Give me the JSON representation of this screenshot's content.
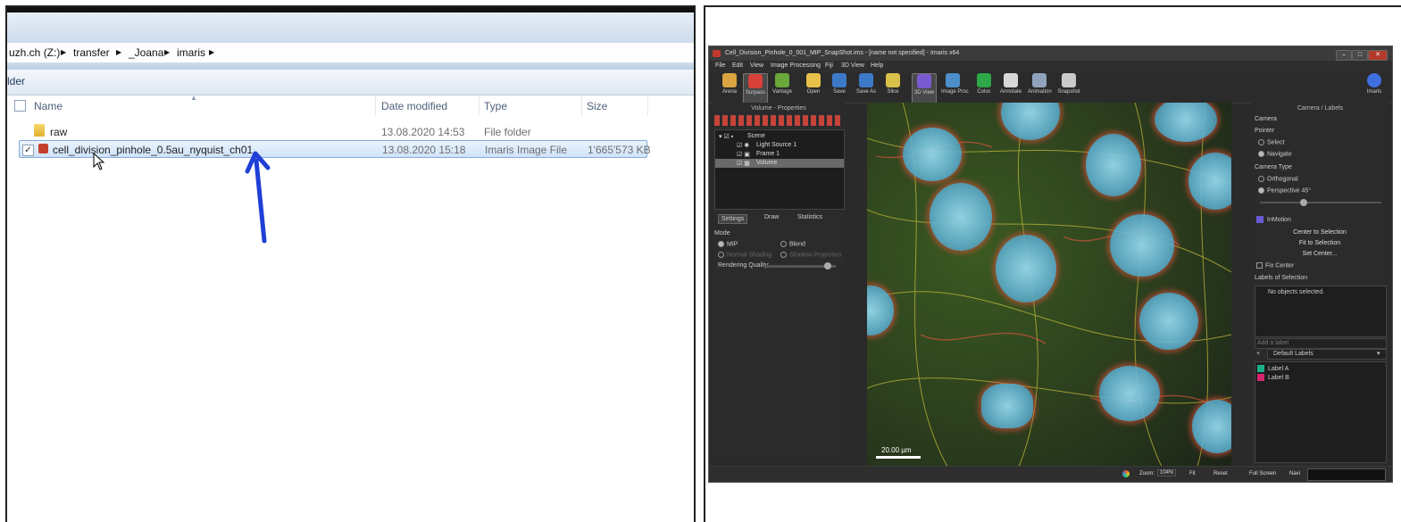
{
  "explorer": {
    "breadcrumb": [
      "uzh.ch (Z:)",
      "transfer",
      "_Joana",
      "imaris"
    ],
    "command_label": "lder",
    "columns": [
      "Name",
      "Date modified",
      "Type",
      "Size"
    ],
    "files": [
      {
        "name": "raw",
        "date": "13.08.2020 14:53",
        "type": "File folder",
        "size": "",
        "icon": "folder-icon",
        "checked": false
      },
      {
        "name": "cell_division_pinhole_0.5au_nyquist_ch01",
        "date": "13.08.2020 15:18",
        "type": "Imaris Image File",
        "size": "1'665'573 KB",
        "icon": "imaris-file-icon",
        "checked": true
      }
    ],
    "annotation": "arrow pointing at the selected Imaris file"
  },
  "imaris": {
    "title": "Cell_Division_Pinhole_0_001_MIP_SnapShot.ims - [name not specified] - Imaris x64",
    "menu": [
      "File",
      "Edit",
      "View",
      "Image Processing",
      "Fiji",
      "3D View",
      "Help"
    ],
    "toolbar": [
      "Arena",
      "Surpass",
      "Vantage",
      "Open",
      "Save",
      "Save As",
      "Slice",
      "3D View",
      "Image Proc",
      "Coloc",
      "Annotate",
      "Animation",
      "Snapshot"
    ],
    "toolbar_right": "Imaris",
    "left_panel": {
      "title": "Volume - Properties",
      "tree": [
        "Scene",
        "Light Source 1",
        "Frame 1",
        "Volume"
      ],
      "tabs": [
        "Settings",
        "Draw",
        "Statistics"
      ],
      "mode_label": "Mode",
      "modes": [
        "MIP",
        "Blend",
        "Normal Shading",
        "Shadow Projection"
      ],
      "quality_label": "Rendering Quality:"
    },
    "viewer": {
      "scale_label": "20.00 µm"
    },
    "right_panel": {
      "title": "Camera / Labels",
      "camera_label": "Camera",
      "pointer_label": "Pointer",
      "pointer_options": [
        "Select",
        "Navigate"
      ],
      "camera_type_label": "Camera Type",
      "camera_type_options": [
        "Orthogonal",
        "Perspective 45°"
      ],
      "inmotion_label": "InMotion",
      "buttons": [
        "Center to Selection",
        "Fit to Selection",
        "Set Center..."
      ],
      "fix_center_label": "Fix Center",
      "labels_of_selection": "Labels of Selection",
      "no_objects": "No objects selected.",
      "add_label_placeholder": "Add a label",
      "default_labels": "Default Labels",
      "labels": [
        {
          "name": "Label A",
          "color": "#1fae8a"
        },
        {
          "name": "Label B",
          "color": "#d6246f"
        }
      ]
    },
    "status": {
      "zoom_label": "Zoom:",
      "zoom_value": "104%",
      "fit": "Fit",
      "reset": "Reset",
      "full_screen": "Full Screen",
      "navi": "Navi"
    }
  }
}
